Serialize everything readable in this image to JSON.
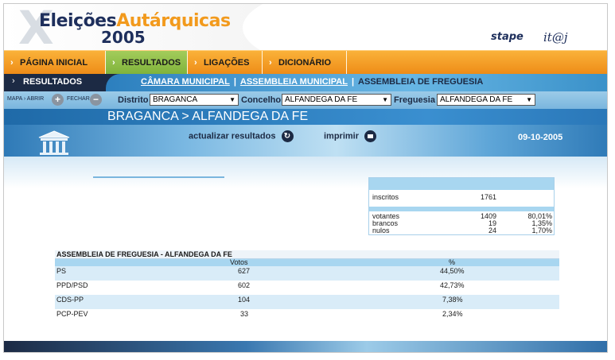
{
  "header": {
    "logo_word1": "Eleições",
    "logo_word2": "Autárquicas",
    "logo_year": "2005",
    "logo_x": "X",
    "brand_stape": "stape",
    "brand_itij": "it@j"
  },
  "nav": {
    "items": [
      {
        "label": "PÁGINA INICIAL"
      },
      {
        "label": "RESULTADOS"
      },
      {
        "label": "LIGAÇÕES"
      },
      {
        "label": "DICIONÁRIO"
      }
    ]
  },
  "resbar": {
    "label": "RESULTADOS",
    "link1": "CÂMARA MUNICIPAL",
    "link2": "ASSEMBLEIA MUNICIPAL",
    "current": "ASSEMBLEIA DE FREGUESIA",
    "sep": "|"
  },
  "filter": {
    "mapa": "MAPA",
    "abrir": "ABRIR",
    "fechar": "FECHAR",
    "distrito_label": "Distrito",
    "distrito_value": "BRAGANCA",
    "concelho_label": "Concelho",
    "concelho_value": "ALFANDEGA DA FE",
    "freguesia_label": "Freguesia",
    "freguesia_value": "ALFANDEGA DA FE"
  },
  "location": {
    "distrito": "BRAGANCA",
    "freguesia": "ALFANDEGA DA FE",
    "separator": ">"
  },
  "actions": {
    "refresh": "actualizar resultados",
    "print": "imprimir",
    "date": "09-10-2005"
  },
  "summary": {
    "inscritos_label": "inscritos",
    "inscritos_value": "1761",
    "votantes_label": "votantes",
    "votantes_value": "1409",
    "votantes_pct": "80,01%",
    "brancos_label": "brancos",
    "brancos_value": "19",
    "brancos_pct": "1,35%",
    "nulos_label": "nulos",
    "nulos_value": "24",
    "nulos_pct": "1,70%"
  },
  "results": {
    "title": "ASSEMBLEIA DE FREGUESIA - ALFANDEGA DA FE",
    "col_votes": "Votos",
    "col_pct": "%",
    "rows": [
      {
        "party": "PS",
        "votes": "627",
        "pct": "44,50%"
      },
      {
        "party": "PPD/PSD",
        "votes": "602",
        "pct": "42,73%"
      },
      {
        "party": "CDS-PP",
        "votes": "104",
        "pct": "7,38%"
      },
      {
        "party": "PCP-PEV",
        "votes": "33",
        "pct": "2,34%"
      }
    ]
  },
  "colors": {
    "orange": "#f29a1d",
    "navy": "#1c2a44",
    "green_active": "#8bbd45",
    "light_blue": "#a8d6f0"
  }
}
